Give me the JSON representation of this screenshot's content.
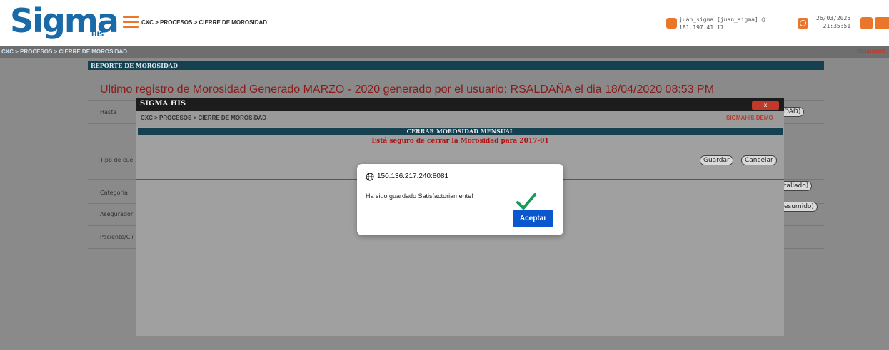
{
  "header": {
    "logo_text": "Sigma",
    "logo_sub": "HIS",
    "breadcrumb": "CXC > PROCESOS > CIERRE DE MOROSIDAD",
    "user_line1": "juan_sigma [juan_sigma] @",
    "user_line2": "181.197.41.17",
    "date": "26/03/2025",
    "time": "21:35:51"
  },
  "subbar": {
    "breadcrumb": "CXC > PROCESOS > CIERRE DE MOROSIDAD",
    "brand": "SIGMAHIS"
  },
  "report": {
    "title": "REPORTE DE MOROSIDAD",
    "last_generated": "Ultimo registro de Morosidad Generado MARZO - 2020 generado por el usuario: RSALDAÑA el dia 18/04/2020 08:53 PM",
    "labels": {
      "hasta": "Hasta",
      "tipo_cuenta": "Tipo de cue",
      "categoria": "Categoria",
      "asegurador": "Asegurador",
      "paciente": "Paciente/Cli"
    },
    "buttons": {
      "morosidad": "DAD)",
      "detallado": "tallado)",
      "resumido": "esumido)"
    }
  },
  "modal": {
    "title": "SIGMA HIS",
    "close_label": "x",
    "breadcrumb": "CXC > PROCESOS > CIERRE DE MOROSIDAD",
    "brand": "SIGMAHIS DEMO",
    "section_title": "CERRAR MOROSIDAD MENSUAL",
    "question": "Está seguro de cerrar la Morosidad para 2017-01",
    "save_label": "Guardar",
    "cancel_label": "Cancelar"
  },
  "alert": {
    "host": "150.136.217.240:8081",
    "message": "Ha sido guardado Satisfactoriamente!",
    "accept_label": "Aceptar"
  },
  "colors": {
    "accent": "#e9762a",
    "dark_bar": "#14404f",
    "warning_red": "#b01212",
    "dialog_button": "#0b57d0",
    "check_green": "#1a9a5a"
  }
}
